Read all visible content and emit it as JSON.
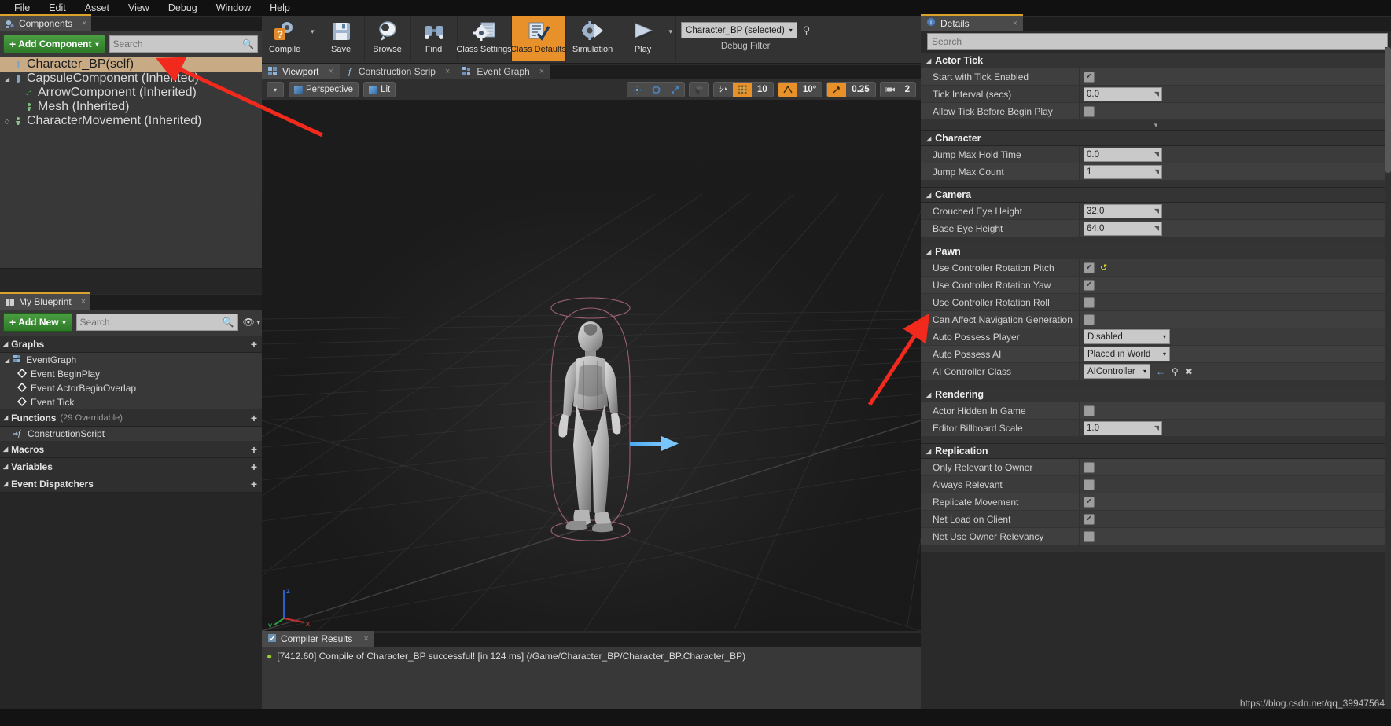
{
  "menubar": {
    "items": [
      "File",
      "Edit",
      "Asset",
      "View",
      "Debug",
      "Window",
      "Help"
    ]
  },
  "components_panel": {
    "tab_label": "Components",
    "tab_close": "×",
    "add_button": "Add Component",
    "add_caret": "▾",
    "search_placeholder": "Search",
    "tree": [
      {
        "label": "Character_BP(self)",
        "icon": "capsule-icon",
        "selected": true,
        "indent": 0,
        "arrow": ""
      },
      {
        "label": "CapsuleComponent (Inherited)",
        "icon": "capsule-icon",
        "selected": false,
        "indent": 0,
        "arrow": "◢"
      },
      {
        "label": "ArrowComponent (Inherited)",
        "icon": "arrow-icon",
        "selected": false,
        "indent": 1,
        "arrow": ""
      },
      {
        "label": "Mesh (Inherited)",
        "icon": "mesh-icon",
        "selected": false,
        "indent": 1,
        "arrow": ""
      },
      {
        "label": "CharacterMovement (Inherited)",
        "icon": "movement-icon",
        "selected": false,
        "indent": 0,
        "arrow": "◇"
      }
    ]
  },
  "my_blueprint": {
    "tab_label": "My Blueprint",
    "tab_close": "×",
    "add_button": "Add New",
    "add_caret": "▾",
    "search_placeholder": "Search",
    "sections": [
      {
        "title": "Graphs",
        "sub": "",
        "add": "+"
      },
      {
        "title": "Functions",
        "sub": "(29 Overridable)",
        "add": "+"
      },
      {
        "title": "Macros",
        "sub": "",
        "add": "+"
      },
      {
        "title": "Variables",
        "sub": "",
        "add": "+"
      },
      {
        "title": "Event Dispatchers",
        "sub": "",
        "add": "+"
      }
    ],
    "graph_items": [
      {
        "label": "EventGraph",
        "type": "graph",
        "indent": 0
      },
      {
        "label": "Event BeginPlay",
        "type": "event",
        "indent": 1
      },
      {
        "label": "Event ActorBeginOverlap",
        "type": "event",
        "indent": 1
      },
      {
        "label": "Event Tick",
        "type": "event",
        "indent": 1
      }
    ],
    "function_items": [
      {
        "label": "ConstructionScript",
        "type": "function",
        "indent": 1
      }
    ]
  },
  "toolbar": {
    "buttons": [
      {
        "label": "Compile",
        "icon": "compile-icon",
        "active": false,
        "has_dropdown": true
      },
      {
        "label": "Save",
        "icon": "save-icon",
        "active": false,
        "has_dropdown": false
      },
      {
        "label": "Browse",
        "icon": "browse-icon",
        "active": false,
        "has_dropdown": false
      },
      {
        "label": "Find",
        "icon": "find-icon",
        "active": false,
        "has_dropdown": false
      },
      {
        "label": "Class Settings",
        "icon": "class-settings-icon",
        "active": false,
        "has_dropdown": false
      },
      {
        "label": "Class Defaults",
        "icon": "class-defaults-icon",
        "active": true,
        "has_dropdown": false
      },
      {
        "label": "Simulation",
        "icon": "simulation-icon",
        "active": false,
        "has_dropdown": false
      },
      {
        "label": "Play",
        "icon": "play-icon",
        "active": false,
        "has_dropdown": true
      }
    ],
    "debug_filter_value": "Character_BP (selected)",
    "debug_filter_caret": "▾",
    "debug_filter_label": "Debug Filter",
    "debug_search_icon": "search-icon"
  },
  "viewport": {
    "tabs": [
      {
        "label": "Viewport",
        "icon": "viewport-icon",
        "active": true,
        "close": "×"
      },
      {
        "label": "Construction Scrip",
        "icon": "function-icon",
        "active": false,
        "close": "×"
      },
      {
        "label": "Event Graph",
        "icon": "graph-icon",
        "active": false,
        "close": "×"
      }
    ],
    "view_mode": "Perspective",
    "lighting_mode": "Lit",
    "menu_caret": "▾",
    "controls": {
      "transform_icons": [
        "move-icon",
        "rotate-icon",
        "scale-icon"
      ],
      "coord_icon": "world-space-icon",
      "snap_icon": "surface-snap-icon",
      "grid_icon": "grid-snap-icon",
      "grid_value": "10",
      "rotation_icon": "rotation-snap-icon",
      "rotation_value": "10°",
      "scale_icon": "scale-snap-icon",
      "scale_value": "0.25",
      "camera_icon": "camera-speed-icon",
      "camera_value": "2"
    },
    "axis_labels": {
      "z": "z",
      "y": "y",
      "x": "x"
    }
  },
  "compiler_results": {
    "tab_label": "Compiler Results",
    "tab_close": "×",
    "message": "[7412.60] Compile of Character_BP successful! [in 124 ms] (/Game/Character_BP/Character_BP.Character_BP)"
  },
  "details": {
    "tab_label": "Details",
    "tab_close": "×",
    "search_placeholder": "Search",
    "categories": [
      {
        "name": "Actor Tick",
        "rows": [
          {
            "label": "Start with Tick Enabled",
            "kind": "checkbox",
            "checked": true
          },
          {
            "label": "Tick Interval (secs)",
            "kind": "number",
            "value": "0.0"
          },
          {
            "label": "Allow Tick Before Begin Play",
            "kind": "checkbox",
            "checked": false
          }
        ],
        "has_expander": true,
        "expander_glyph": "▾"
      },
      {
        "name": "Character",
        "rows": [
          {
            "label": "Jump Max Hold Time",
            "kind": "number",
            "value": "0.0"
          },
          {
            "label": "Jump Max Count",
            "kind": "number",
            "value": "1"
          }
        ]
      },
      {
        "name": "Camera",
        "rows": [
          {
            "label": "Crouched Eye Height",
            "kind": "number",
            "value": "32.0"
          },
          {
            "label": "Base Eye Height",
            "kind": "number",
            "value": "64.0"
          }
        ]
      },
      {
        "name": "Pawn",
        "rows": [
          {
            "label": "Use Controller Rotation Pitch",
            "kind": "checkbox",
            "checked": true,
            "revert": "↺"
          },
          {
            "label": "Use Controller Rotation Yaw",
            "kind": "checkbox",
            "checked": true
          },
          {
            "label": "Use Controller Rotation Roll",
            "kind": "checkbox",
            "checked": false
          },
          {
            "label": "Can Affect Navigation Generation",
            "kind": "checkbox",
            "checked": false
          },
          {
            "label": "Auto Possess Player",
            "kind": "dropdown",
            "value": "Disabled",
            "caret": "▾"
          },
          {
            "label": "Auto Possess AI",
            "kind": "dropdown",
            "value": "Placed in World",
            "caret": "▾"
          },
          {
            "label": "AI Controller Class",
            "kind": "class",
            "value": "AIController",
            "caret": "▾",
            "icons": [
              "use-selected-icon",
              "browse-icon",
              "clear-icon"
            ]
          }
        ]
      },
      {
        "name": "Rendering",
        "rows": [
          {
            "label": "Actor Hidden In Game",
            "kind": "checkbox",
            "checked": false
          },
          {
            "label": "Editor Billboard Scale",
            "kind": "number",
            "value": "1.0"
          }
        ]
      },
      {
        "name": "Replication",
        "rows": [
          {
            "label": "Only Relevant to Owner",
            "kind": "checkbox",
            "checked": false
          },
          {
            "label": "Always Relevant",
            "kind": "checkbox",
            "checked": false
          },
          {
            "label": "Replicate Movement",
            "kind": "checkbox",
            "checked": true
          },
          {
            "label": "Net Load on Client",
            "kind": "checkbox",
            "checked": true
          },
          {
            "label": "Net Use Owner Relevancy",
            "kind": "checkbox",
            "checked": false
          }
        ]
      }
    ]
  },
  "watermark": "https://blog.csdn.net/qq_39947564",
  "colors": {
    "accent_orange": "#e8912a",
    "green_button": "#3f8c36",
    "selection_tan": "#c8ab84",
    "annotation_red": "#f22a1e",
    "revert_yellow": "#e6e02f"
  }
}
